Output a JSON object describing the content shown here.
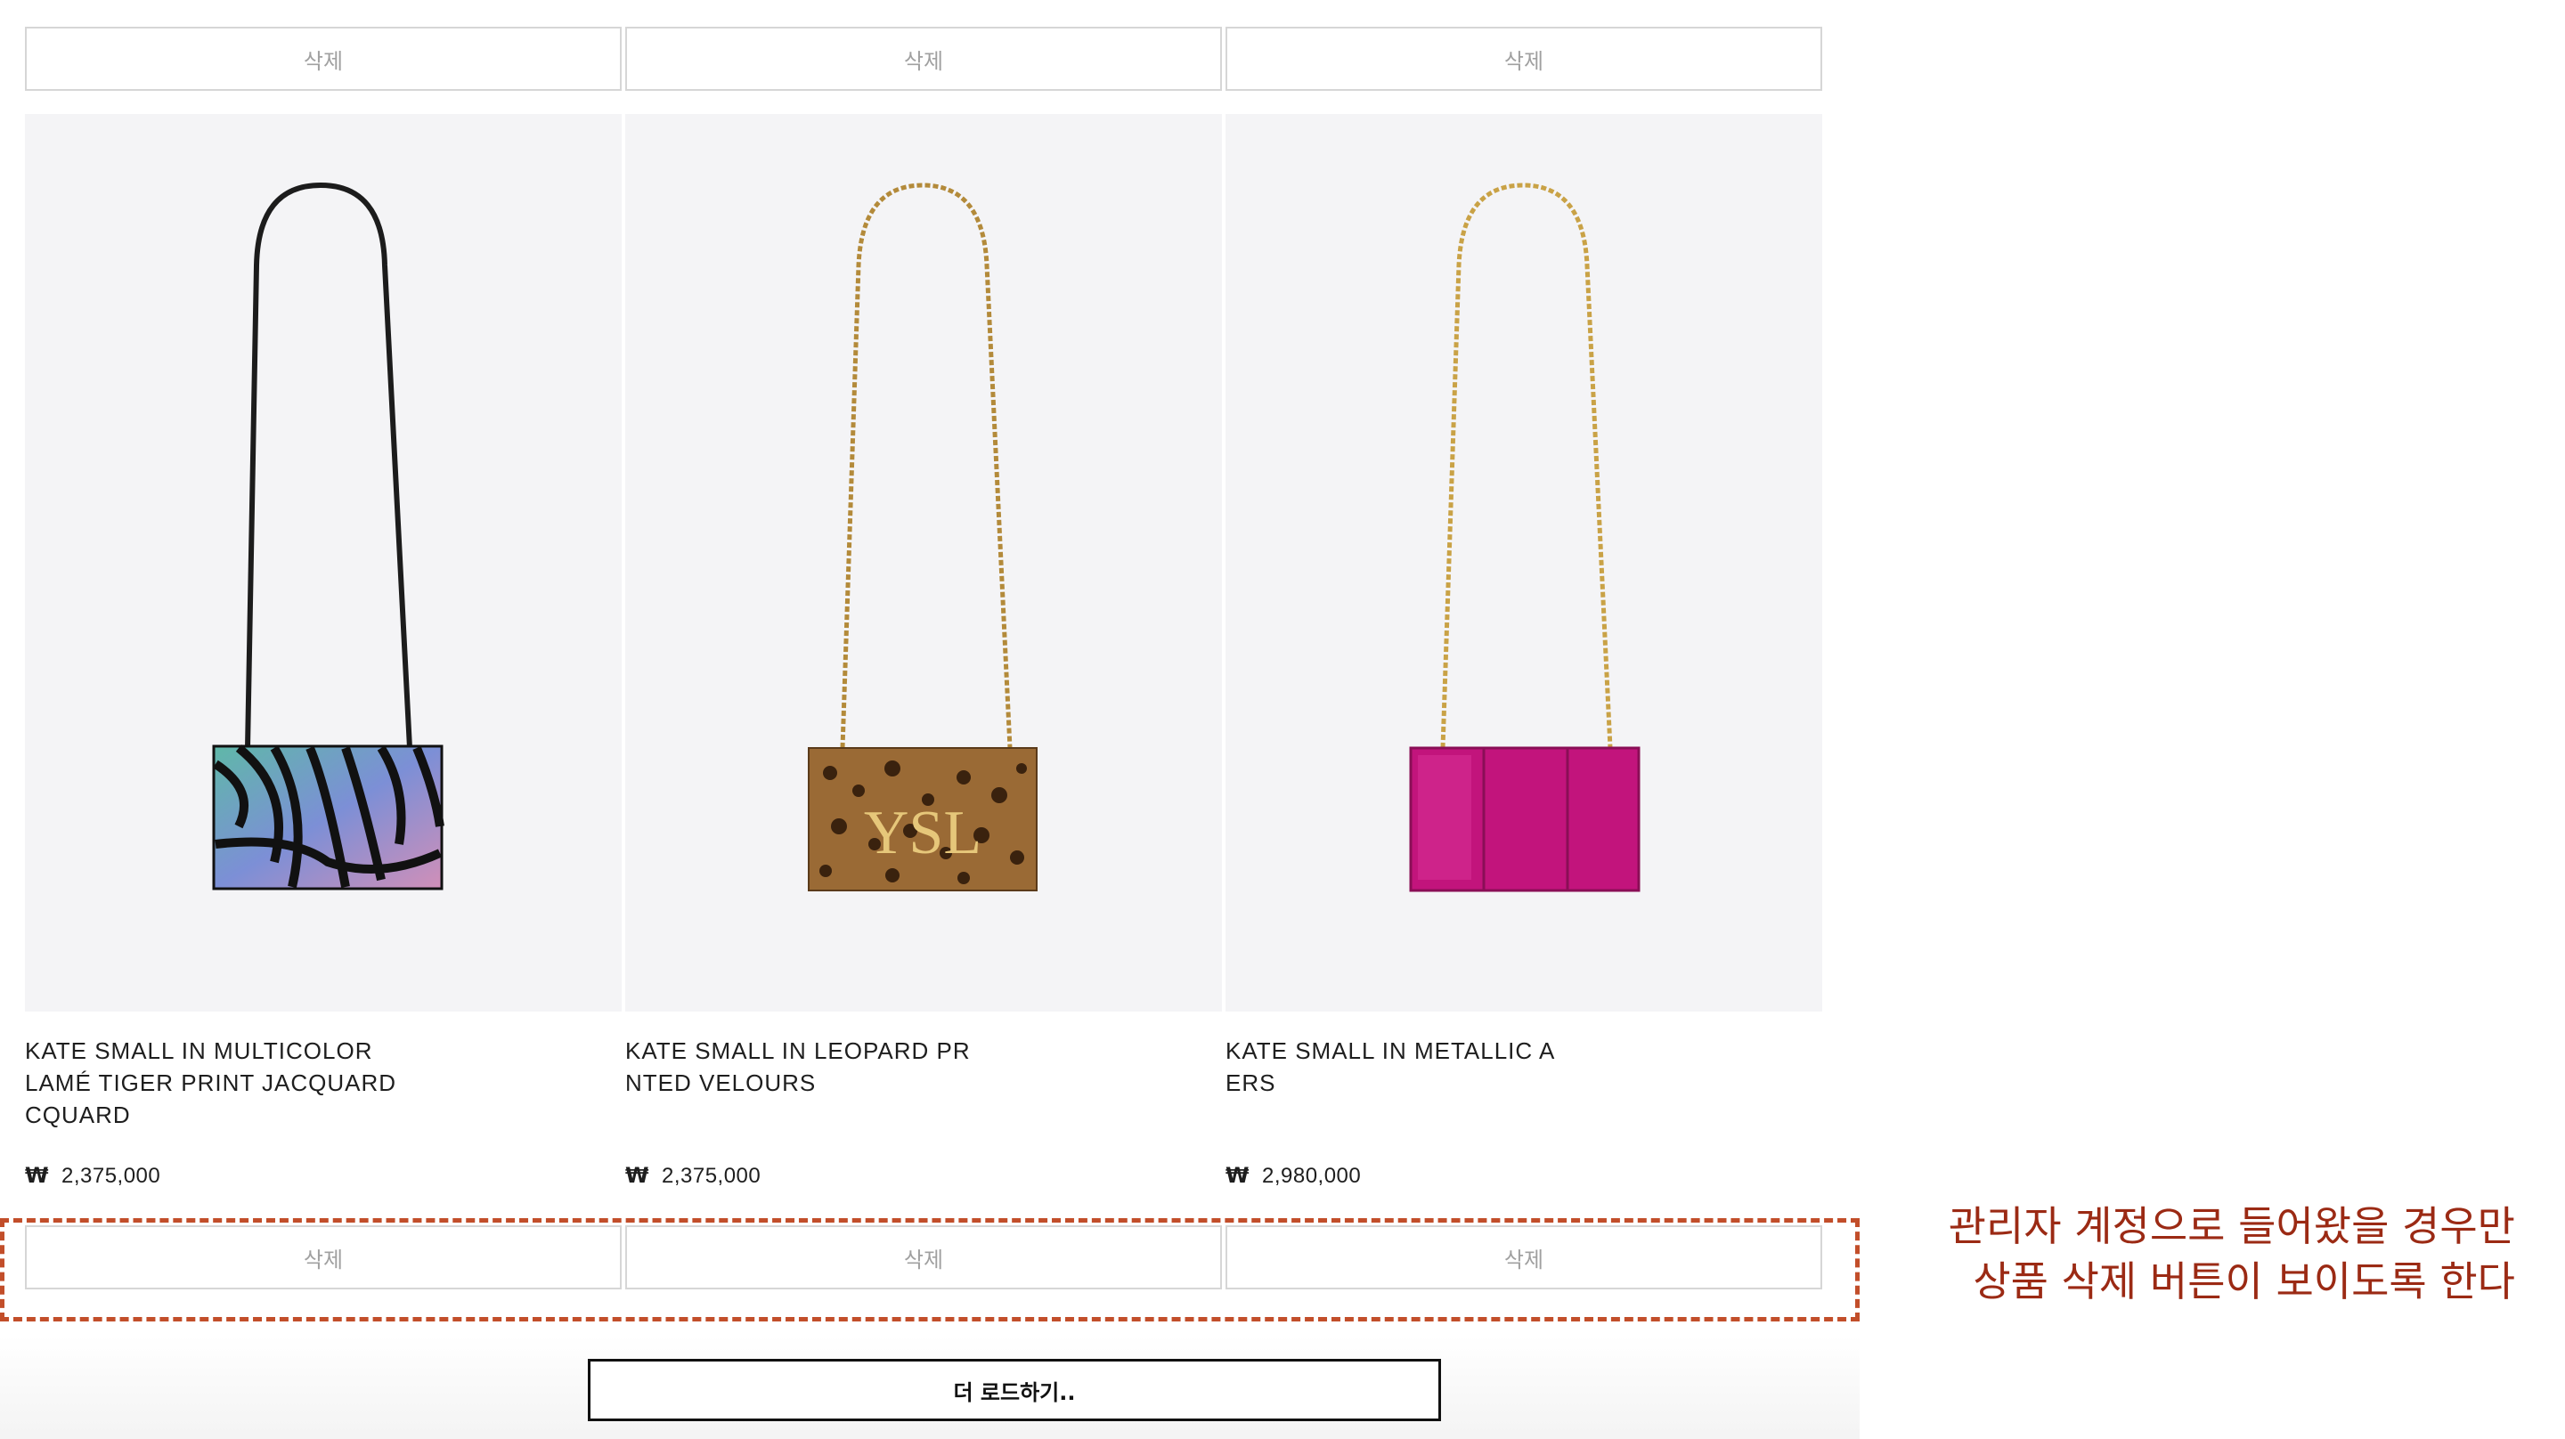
{
  "products": [
    {
      "title_lines": [
        "KATE SMALL IN MULTICOLOR",
        "LAMÉ TIGER PRINT JACQUARD",
        "CQUARD"
      ],
      "currency": "₩",
      "price": "2,375,000",
      "delete_top_label": "삭제",
      "delete_bottom_label": "삭제",
      "image": "multicolor-tiger-print-bag"
    },
    {
      "title_lines": [
        "KATE SMALL IN LEOPARD PR",
        "NTED VELOURS"
      ],
      "currency": "₩",
      "price": "2,375,000",
      "delete_top_label": "삭제",
      "delete_bottom_label": "삭제",
      "image": "leopard-print-bag"
    },
    {
      "title_lines": [
        "KATE SMALL IN METALLIC A",
        "ERS"
      ],
      "currency": "₩",
      "price": "2,980,000",
      "delete_top_label": "삭제",
      "delete_bottom_label": "삭제",
      "image": "metallic-pink-bag"
    }
  ],
  "load_more_label": "더 로드하기..",
  "annotation": {
    "line1": "관리자 계정으로 들어왔을 경우만",
    "line2": "상품 삭제 버튼이 보이도록 한다",
    "color": "#9b2a14",
    "border_color": "#c24e2a"
  }
}
